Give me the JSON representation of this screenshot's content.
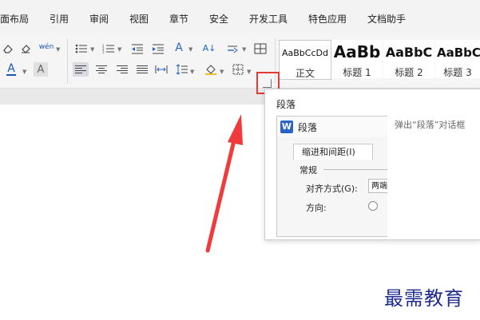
{
  "menu_tabs": [
    "页面布局",
    "引用",
    "审阅",
    "视图",
    "章节",
    "安全",
    "开发工具",
    "特色应用",
    "文档助手"
  ],
  "ribbon": {
    "phonetic_label": "wén",
    "font_color_label": "A",
    "char_shading_label": "A",
    "sort_label": "A↓",
    "text_tool_label": "A"
  },
  "styles": [
    {
      "sample": "AaBbCcDd",
      "label": "正文",
      "selected": true
    },
    {
      "sample": "AaBb",
      "label": "标题 1"
    },
    {
      "sample": "AaBbC",
      "label": "标题 2"
    },
    {
      "sample": "AaBbC",
      "label": "标题 3"
    }
  ],
  "tooltip": {
    "title": "段落",
    "description": "弹出“段落”对话框",
    "preview": {
      "dialog_title": "段落",
      "tab": "缩进和间距(I)",
      "section": "常规",
      "align_label": "对齐方式(G):",
      "align_value": "两端",
      "direction_label": "方向:"
    }
  },
  "watermark": "最需教育",
  "colors": {
    "highlight": "#e53935",
    "arrow": "#ef3b3b",
    "accent": "#2b63c6",
    "watermark": "#1e2b8f"
  }
}
